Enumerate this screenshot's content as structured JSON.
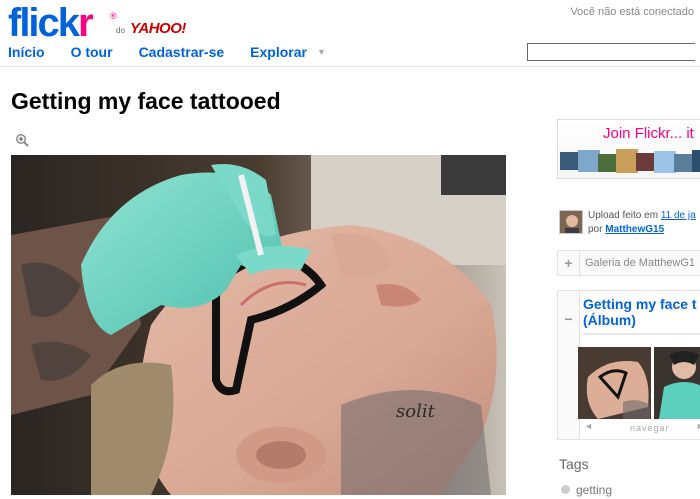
{
  "header": {
    "logo_part1": "flick",
    "logo_part2": "r",
    "logo_reg": "®",
    "logo_do": "do",
    "logo_yahoo": "YAHOO!",
    "status_text": "Você não está conectado",
    "nav": [
      {
        "label": "Início"
      },
      {
        "label": "O tour"
      },
      {
        "label": "Cadastrar-se"
      },
      {
        "label": "Explorar"
      }
    ],
    "explorar_caret": "▼",
    "search_value": ""
  },
  "photo": {
    "title": "Getting my face tattooed",
    "zoom_icon": "magnifier-plus-icon",
    "neck_tattoo_text": "solit"
  },
  "sidebar": {
    "join_text": "Join Flickr... it",
    "upload_prefix": "Upload feito em",
    "upload_date": "11 de ja",
    "upload_by": "por",
    "uploader": "MatthewG15",
    "gallery_label": "Galeria de MatthewG1",
    "gallery_icon": "plus-icon",
    "album_title_line1": "Getting my face t",
    "album_title_line2": "(Álbum)",
    "album_icon": "minus-icon",
    "album_nav_left": "◄",
    "album_nav_text": "navegar",
    "album_nav_right": "►",
    "tags_heading": "Tags",
    "tags": [
      {
        "label": "getting"
      }
    ]
  },
  "colors": {
    "flickr_blue": "#0063dc",
    "flickr_pink": "#ff0084",
    "yahoo_red": "#cc0000"
  }
}
